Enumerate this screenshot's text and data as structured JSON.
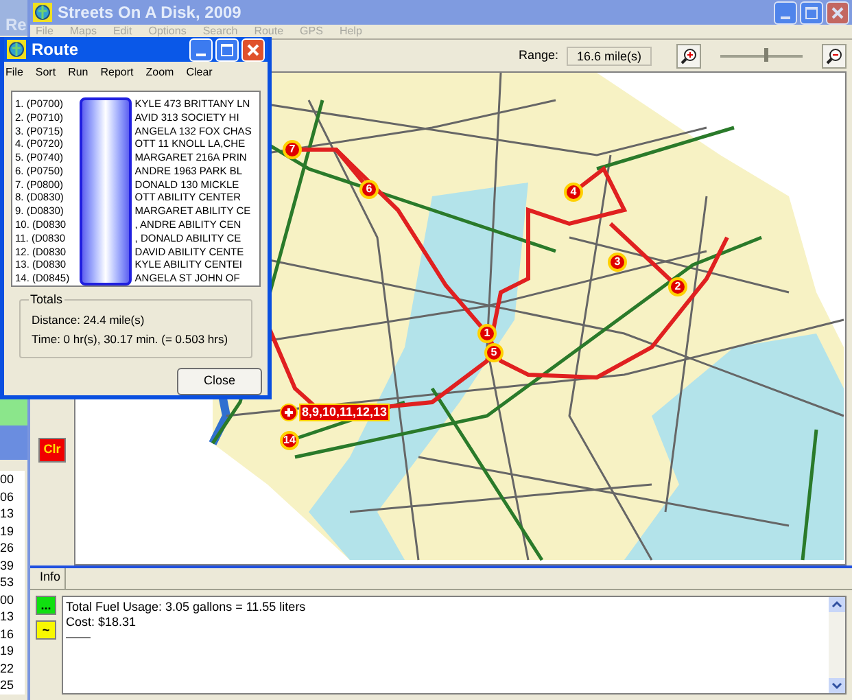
{
  "background_window": {
    "title": "Re"
  },
  "left_panel": {
    "times": [
      "00",
      "06",
      "13",
      "19",
      "26",
      "39",
      "53",
      "00",
      "13",
      "16",
      "19",
      "22",
      "25"
    ]
  },
  "window": {
    "title": "Streets On A Disk, 2009"
  },
  "menu": [
    "File",
    "Maps",
    "Edit",
    "Options",
    "Search",
    "Route",
    "GPS",
    "Help"
  ],
  "toolbar": {
    "range_label": "Range:",
    "range_value": "16.6 mile(s)",
    "zoom_slider": {
      "level": 0.55
    }
  },
  "map": {
    "route_stops": [
      {
        "label": "1"
      },
      {
        "label": "2"
      },
      {
        "label": "3"
      },
      {
        "label": "4"
      },
      {
        "label": "5"
      },
      {
        "label": "6"
      },
      {
        "label": "7"
      },
      {
        "label": "8,9,10,11,12,13"
      },
      {
        "label": "14"
      }
    ]
  },
  "clear_button": "Clr",
  "info_panel": {
    "tab": "Info",
    "buttons": [
      "...",
      "~"
    ],
    "lines": [
      "Total Fuel Usage: 3.05 gallons = 11.55 liters",
      "Cost: $18.31",
      "——"
    ]
  },
  "route_window": {
    "title": "Route",
    "menu": [
      "File",
      "Sort",
      "Run",
      "Report",
      "Zoom",
      "Clear"
    ],
    "rows": [
      {
        "code": "1. (P0700)",
        "visible_text": "KYLE 473 BRITTANY LN"
      },
      {
        "code": "2. (P0710)",
        "visible_text": "AVID 313 SOCIETY HI"
      },
      {
        "code": "3. (P0715)",
        "visible_text": "ANGELA 132 FOX CHAS"
      },
      {
        "code": "4. (P0720)",
        "visible_text": "OTT 11 KNOLL LA,CHE"
      },
      {
        "code": "5. (P0740)",
        "visible_text": "MARGARET 216A PRIN"
      },
      {
        "code": "6. (P0750)",
        "visible_text": "ANDRE 1963 PARK BL"
      },
      {
        "code": "7. (P0800)",
        "visible_text": "DONALD 130 MICKLE"
      },
      {
        "code": "8. (D0830)",
        "visible_text": "OTT ABILITY CENTER"
      },
      {
        "code": "9. (D0830)",
        "visible_text": "MARGARET ABILITY CE"
      },
      {
        "code": "10. (D0830",
        "visible_text": ", ANDRE ABILITY CEN"
      },
      {
        "code": "11. (D0830",
        "visible_text": ", DONALD ABILITY CE"
      },
      {
        "code": "12. (D0830",
        "visible_text": "DAVID ABILITY CENTE"
      },
      {
        "code": "13. (D0830",
        "visible_text": "KYLE ABILITY CENTEI"
      },
      {
        "code": "14. (D0845)",
        "visible_text": "ANGELA ST JOHN OF"
      }
    ],
    "totals": {
      "legend": "Totals",
      "distance": "Distance: 24.4 mile(s)",
      "time": "Time: 0 hr(s), 30.17 min. (= 0.503 hrs)"
    },
    "close_button": "Close"
  }
}
